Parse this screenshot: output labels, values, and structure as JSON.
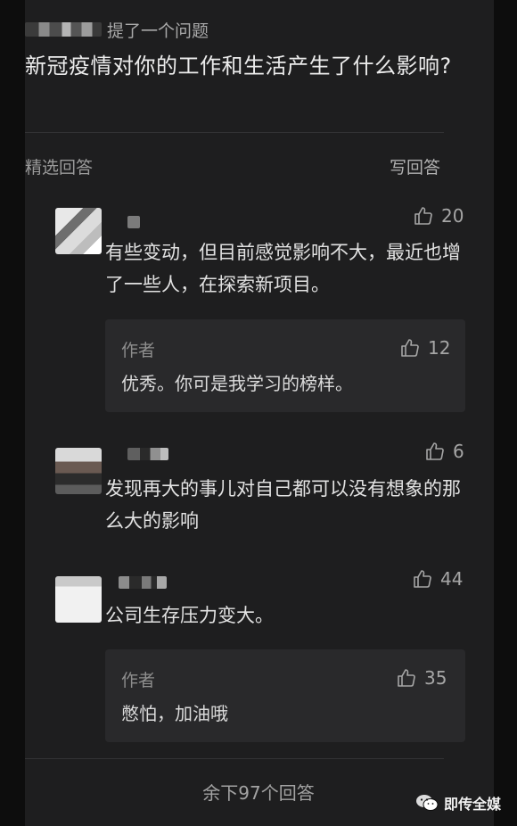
{
  "question": {
    "asker_action": "提了一个问题",
    "title": "新冠疫情对你的工作和生活产生了什么影响?"
  },
  "tabs": {
    "featured_label": "精选回答",
    "write_label": "写回答"
  },
  "answers": [
    {
      "likes": "20",
      "text": "有些变动，但目前感觉影响不大，最近也增了一些人，在探索新项目。",
      "reply": {
        "author": "作者",
        "likes": "12",
        "text": "优秀。你可是我学习的榜样。"
      }
    },
    {
      "likes": "6",
      "text": "发现再大的事儿对自己都可以没有想象的那么大的影响"
    },
    {
      "likes": "44",
      "text": "公司生存压力变大。",
      "reply": {
        "author": "作者",
        "likes": "35",
        "text": "憋怕，加油哦"
      }
    }
  ],
  "footer": {
    "more_label": "余下97个回答"
  },
  "watermark": {
    "text": "即传全媒",
    "icon": "wechat-icon"
  },
  "colors": {
    "background": "#1e1e1f",
    "reply_bg": "#29292b",
    "text": "#e2e2e2",
    "muted": "#9a9a9a"
  }
}
